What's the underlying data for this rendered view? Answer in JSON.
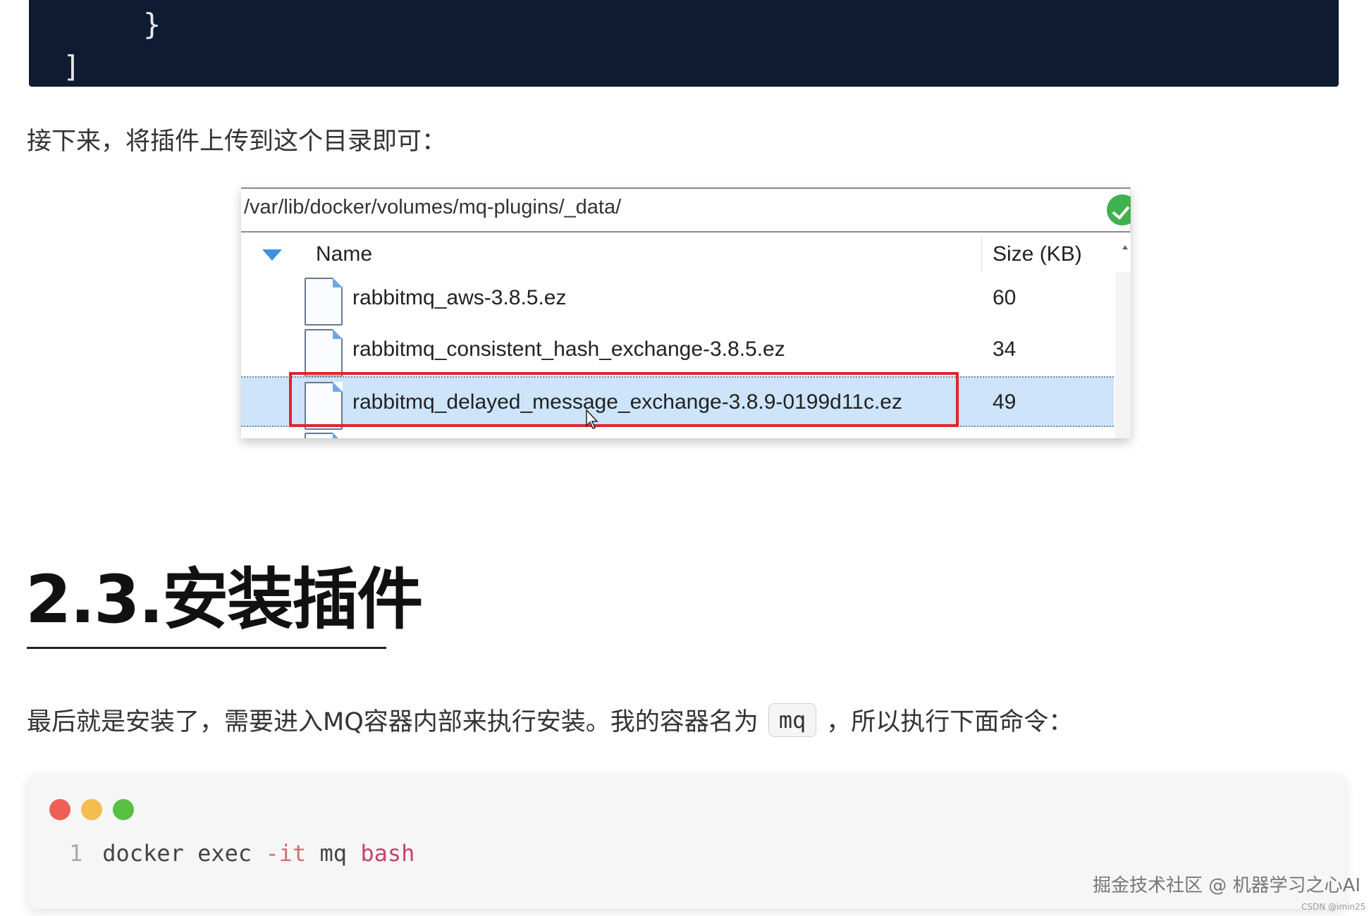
{
  "code_top": {
    "brace": "}",
    "bracket": "]",
    "tick": "'"
  },
  "paragraph1": "接下来，将插件上传到这个目录即可：",
  "file_manager": {
    "path": "/var/lib/docker/volumes/mq-plugins/_data/",
    "columns": {
      "name": "Name",
      "size": "Size (KB)"
    },
    "files": [
      {
        "name": "rabbitmq_aws-3.8.5.ez",
        "size": "60"
      },
      {
        "name": "rabbitmq_consistent_hash_exchange-3.8.5.ez",
        "size": "34"
      },
      {
        "name": "rabbitmq_delayed_message_exchange-3.8.9-0199d11c.ez",
        "size": "49",
        "selected": true
      }
    ],
    "highlight_color": "#e0242b",
    "selected_color": "#cde4fb"
  },
  "heading": "2.3.安装插件",
  "paragraph2": {
    "before": "最后就是安装了，需要进入MQ容器内部来执行安装。我的容器名为",
    "code": "mq",
    "after": "，所以执行下面命令："
  },
  "terminal": {
    "line_number": "1",
    "tokens": {
      "cmd": "docker exec ",
      "flag": "-it",
      "arg": " mq ",
      "kw": "bash"
    }
  },
  "watermark": "掘金技术社区 @ 机器学习之心AI",
  "watermark_small": "CSDN @imin25"
}
